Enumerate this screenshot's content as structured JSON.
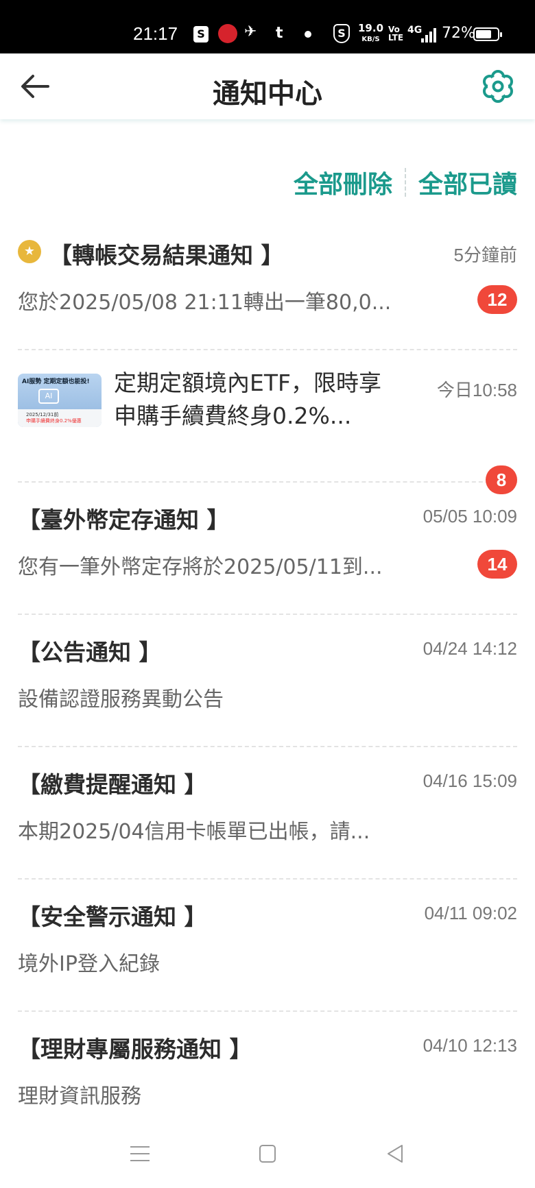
{
  "status_bar": {
    "time": "21:17",
    "speed": "19.0",
    "speed_unit": "KB/S",
    "volte_top": "Vo",
    "volte_bottom": "LTE",
    "network": "4G",
    "battery": "72%",
    "battery_level": 0.72
  },
  "header": {
    "title": "通知中心"
  },
  "actions": {
    "delete_all": "全部刪除",
    "read_all": "全部已讀"
  },
  "notifications": [
    {
      "title": "【轉帳交易結果通知 】",
      "time": "5分鐘前",
      "desc": "您於2025/05/08 21:11轉出一筆80,0...",
      "badge": "12",
      "pinned": true
    },
    {
      "title": "定期定額境內ETF，限時享申購手續費終身0.2%...",
      "time": "今日10:58",
      "badge": "8",
      "thumb": {
        "line1": "AI服勢 定期定額也能投!",
        "ai": "AI",
        "line2": "2025/12/31前",
        "line3": "申購手續費終身0.2%優惠"
      }
    },
    {
      "title": "【臺外幣定存通知 】",
      "time": "05/05 10:09",
      "desc": "您有一筆外幣定存將於2025/05/11到...",
      "badge": "14"
    },
    {
      "title": "【公告通知 】",
      "time": "04/24 14:12",
      "desc": "設備認證服務異動公告"
    },
    {
      "title": "【繳費提醒通知 】",
      "time": "04/16 15:09",
      "desc": "本期2025/04信用卡帳單已出帳，請..."
    },
    {
      "title": "【安全警示通知 】",
      "time": "04/11 09:02",
      "desc": "境外IP登入紀錄"
    },
    {
      "title": "【理財專屬服務通知 】",
      "time": "04/10 12:13",
      "desc": "理財資訊服務"
    }
  ],
  "colors": {
    "accent": "#1b9a8c",
    "badge": "#f0483a",
    "pin": "#e8b73c"
  }
}
